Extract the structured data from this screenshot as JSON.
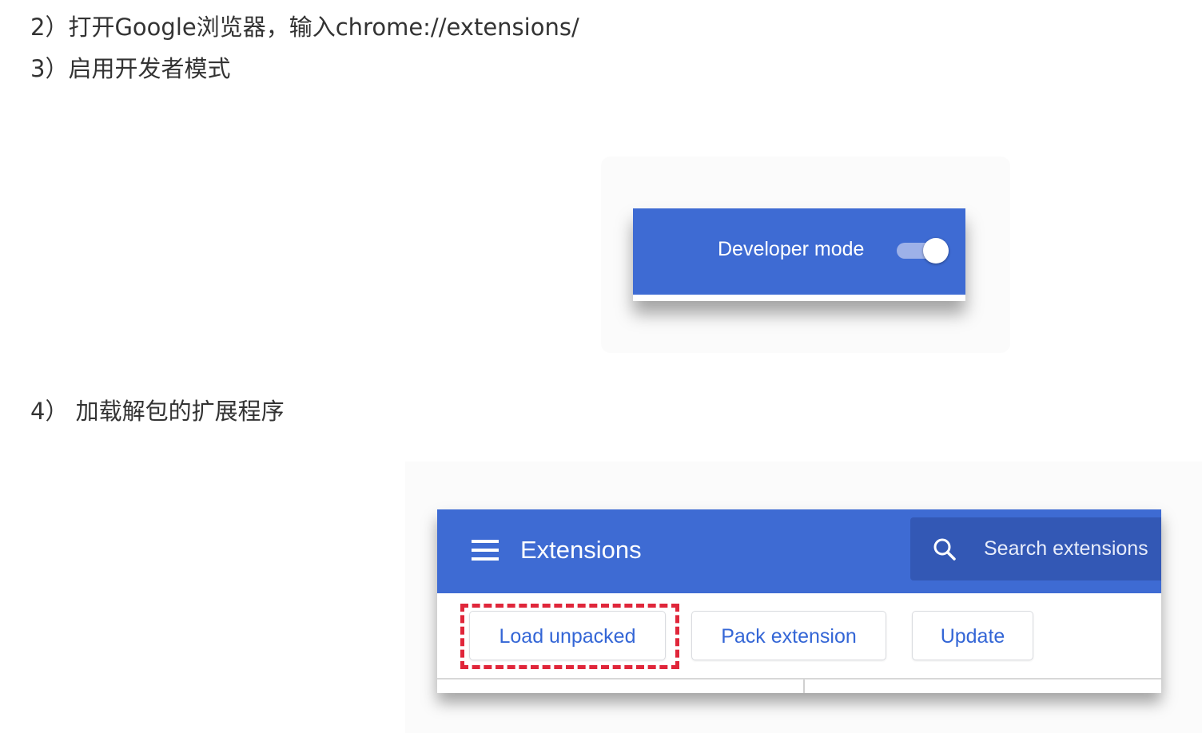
{
  "steps": {
    "step2": "2）打开Google浏览器，输入chrome://extensions/",
    "step3": "3）启用开发者模式",
    "step4": "4） 加载解包的扩展程序"
  },
  "developer_panel": {
    "label": "Developer mode",
    "toggle_on": true,
    "bar_color": "#3e6bd3"
  },
  "extensions_page": {
    "menu_icon": "hamburger-menu-icon",
    "title": "Extensions",
    "search": {
      "icon": "search-icon",
      "placeholder": "Search extensions"
    },
    "toolbar": {
      "load_unpacked_label": "Load unpacked",
      "pack_extension_label": "Pack extension",
      "update_label": "Update"
    },
    "header_color": "#3e6bd3",
    "button_text_color": "#3466d6",
    "highlight_color": "#e0263a"
  }
}
